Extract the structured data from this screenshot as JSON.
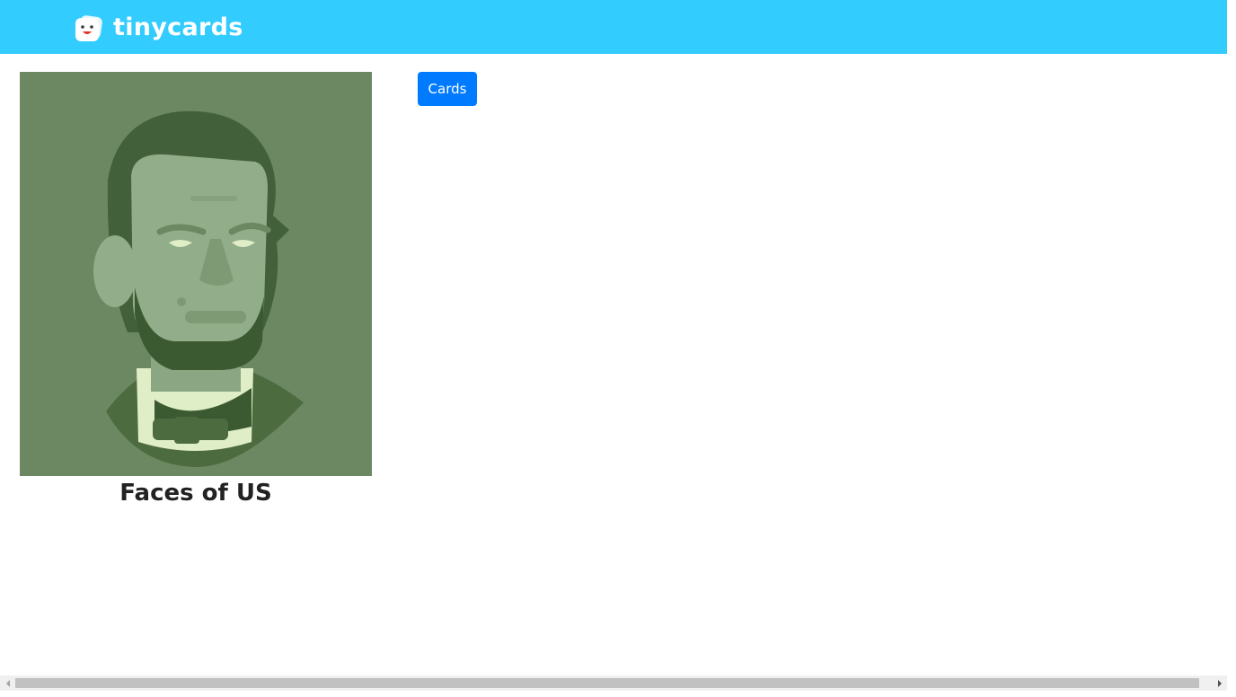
{
  "header": {
    "brand": "tinycards",
    "color": "#33ccff",
    "logo_icon": "tinycards-logo-icon"
  },
  "deck": {
    "title": "Faces of US",
    "image_icon": "abraham-lincoln-illustration",
    "image_bg": "#6b8862"
  },
  "actions": {
    "cards_label": "Cards",
    "cards_color": "#007bff"
  },
  "scrollbar": {
    "orientation": "horizontal"
  }
}
